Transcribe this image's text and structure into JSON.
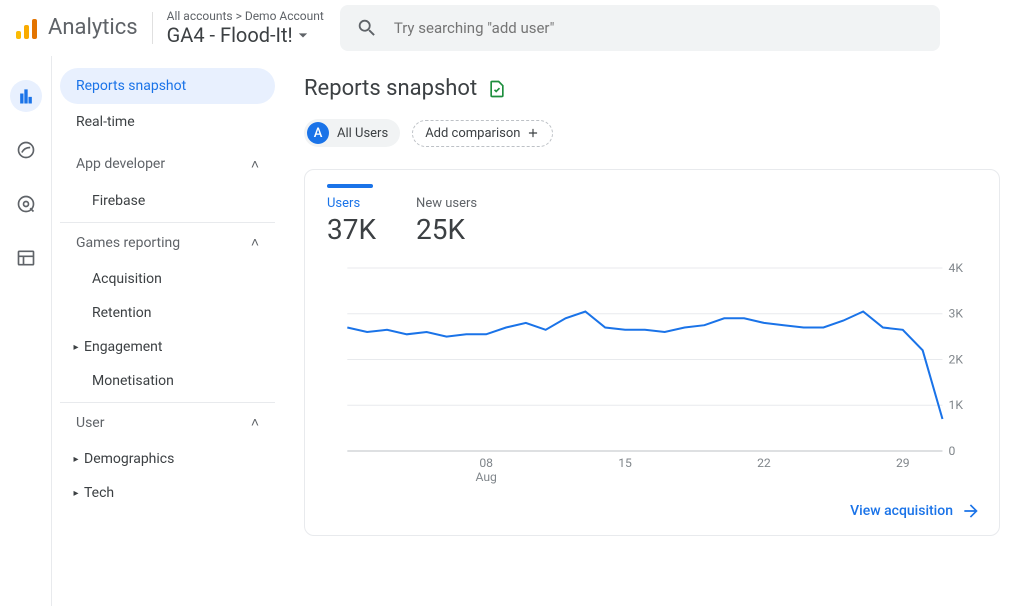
{
  "app_title": "Analytics",
  "breadcrumb": "All accounts > Demo Account",
  "property": "GA4 - Flood-It!",
  "search_placeholder": "Try searching \"add user\"",
  "sidebar": {
    "snapshot": "Reports snapshot",
    "realtime": "Real-time",
    "groups": [
      {
        "label": "App developer",
        "items": [
          "Firebase"
        ],
        "carets": [
          false
        ]
      },
      {
        "label": "Games reporting",
        "items": [
          "Acquisition",
          "Retention",
          "Engagement",
          "Monetisation"
        ],
        "carets": [
          false,
          false,
          true,
          false
        ]
      },
      {
        "label": "User",
        "items": [
          "Demographics",
          "Tech"
        ],
        "carets": [
          true,
          true
        ]
      }
    ]
  },
  "page_title": "Reports snapshot",
  "chips": {
    "all_users_badge": "A",
    "all_users": "All Users",
    "add_comparison": "Add comparison"
  },
  "metrics": {
    "users_label": "Users",
    "users_value": "37K",
    "newusers_label": "New users",
    "newusers_value": "25K"
  },
  "view_link": "View acquisition",
  "chart_data": {
    "type": "line",
    "x_month": "Aug",
    "x_ticks": [
      "08",
      "15",
      "22",
      "29"
    ],
    "y_ticks": [
      "0",
      "1K",
      "2K",
      "3K",
      "4K"
    ],
    "ylim": [
      0,
      4000
    ],
    "series": [
      {
        "name": "Users",
        "color": "#1a73e8",
        "values": [
          2700,
          2600,
          2650,
          2550,
          2600,
          2500,
          2550,
          2550,
          2700,
          2800,
          2650,
          2900,
          3050,
          2700,
          2650,
          2650,
          2600,
          2700,
          2750,
          2900,
          2900,
          2800,
          2750,
          2700,
          2700,
          2850,
          3050,
          2700,
          2650,
          2200,
          700
        ]
      }
    ]
  }
}
